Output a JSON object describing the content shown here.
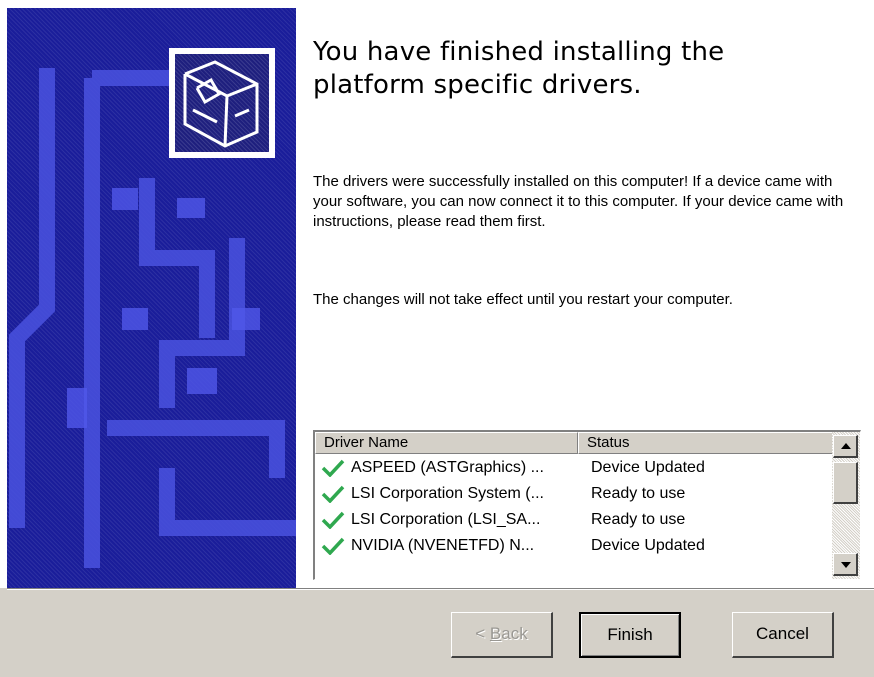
{
  "wizard": {
    "title": "You have finished installing the platform specific drivers.",
    "paragraph1": "The drivers were successfully installed on this computer! If a device came with your software, you can now connect it to this computer. If your device came with instructions, please read them first.",
    "paragraph2": "The changes will not take effect until you restart your computer."
  },
  "driver_list": {
    "columns": [
      "Driver Name",
      "Status"
    ],
    "rows": [
      {
        "name": "ASPEED (ASTGraphics) ...",
        "status": "Device Updated",
        "icon": "check-icon"
      },
      {
        "name": "LSI Corporation System  (...",
        "status": "Ready to use",
        "icon": "check-icon"
      },
      {
        "name": "LSI Corporation (LSI_SA...",
        "status": "Ready to use",
        "icon": "check-icon"
      },
      {
        "name": "NVIDIA (NVENETFD) N...",
        "status": "Device Updated",
        "icon": "check-icon"
      }
    ]
  },
  "buttons": {
    "back_prefix": "< ",
    "back_mnemonic": "B",
    "back_rest": "ack",
    "finish": "Finish",
    "cancel": "Cancel"
  },
  "colors": {
    "banner": "#1a1d9a",
    "check": "#2fa84f",
    "face": "#d4d0c8"
  }
}
